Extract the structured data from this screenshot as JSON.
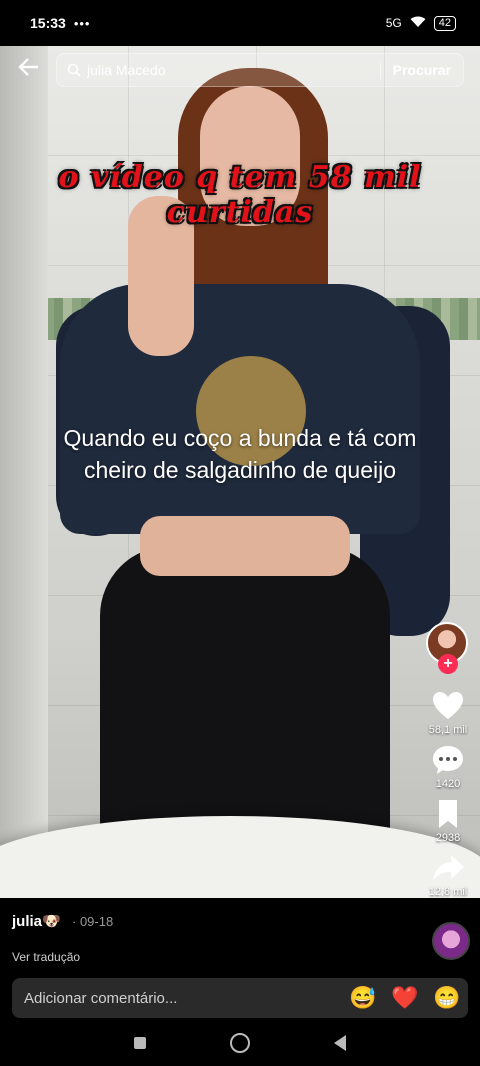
{
  "status_bar": {
    "time": "15:33",
    "extra": "•••",
    "network": "5G",
    "battery": "42"
  },
  "search": {
    "value": "julia Macedo",
    "button": "Procurar"
  },
  "video": {
    "overlay_title": "o vídeo q  tem 58 mil curtidas",
    "caption": "Quando eu coço a bunda e tá com cheiro de salgadinho de queijo"
  },
  "actions": {
    "likes": "58,1 mil",
    "comments": "1420",
    "saves": "2938",
    "shares": "12,8 mil"
  },
  "post": {
    "user": "julia🐶",
    "date": "· 09-18",
    "translate": "Ver tradução"
  },
  "comment_bar": {
    "placeholder": "Adicionar comentário...",
    "emojis": [
      "😅",
      "❤️",
      "😁"
    ]
  },
  "colors": {
    "accent": "#fe2c55",
    "overlay_text": "#e1121a"
  }
}
